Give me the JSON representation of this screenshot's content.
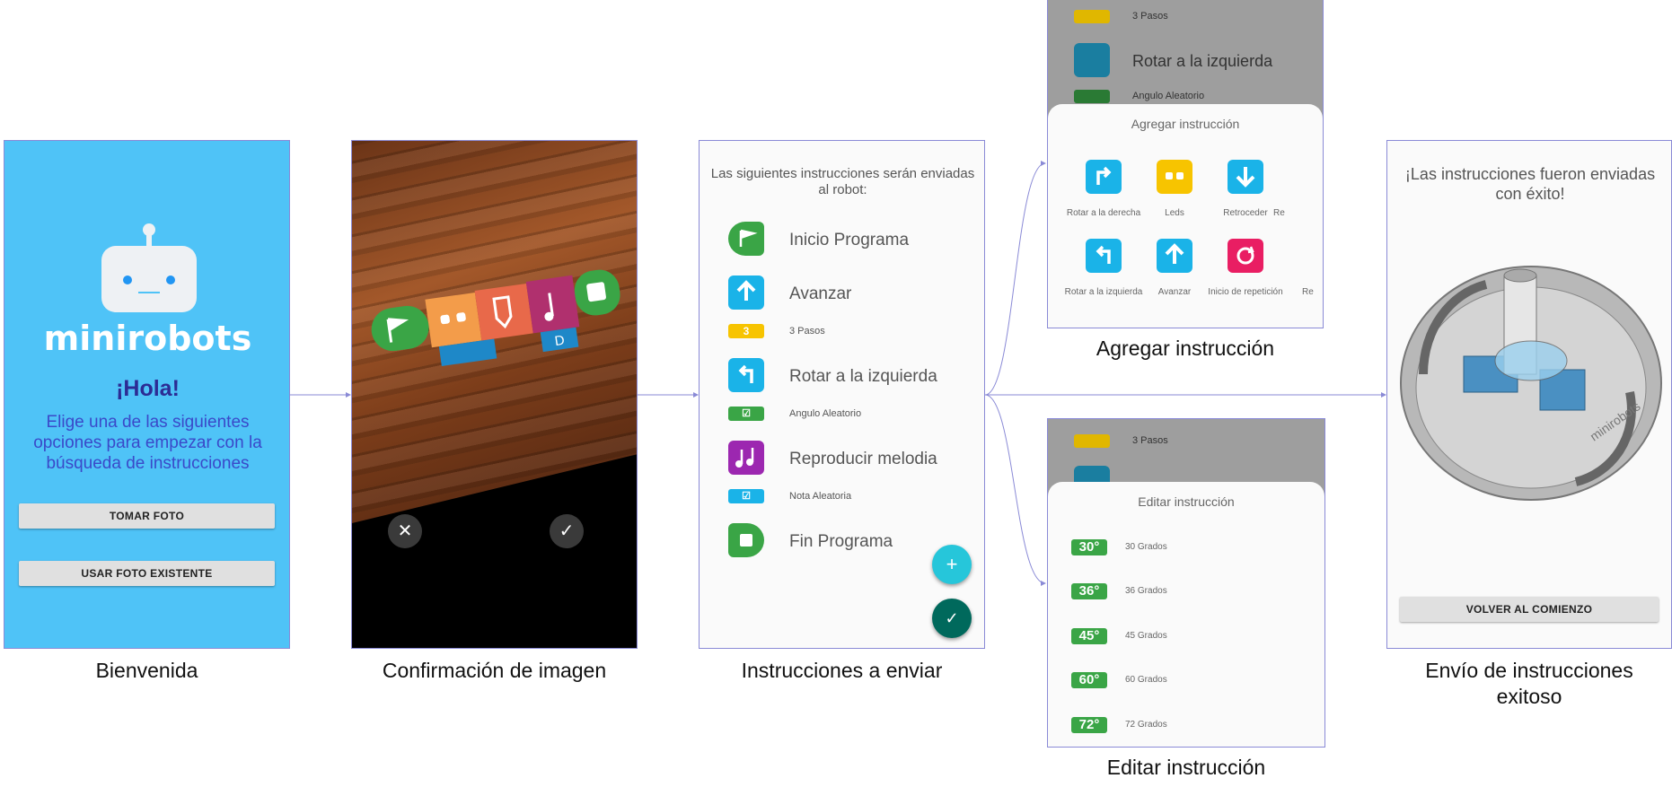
{
  "screens": {
    "welcome": {
      "brand": "minirobots",
      "greeting": "¡Hola!",
      "message": "Elige una de las siguientes opciones para empezar con la búsqueda de instrucciones",
      "take_photo": "TOMAR FOTO",
      "use_existing": "USAR FOTO EXISTENTE",
      "caption": "Bienvenida",
      "bg_color": "#4fc3f7"
    },
    "photo_confirm": {
      "block_label": "D",
      "cancel_icon": "✕",
      "confirm_icon": "✓",
      "caption": "Confirmación de imagen"
    },
    "instructions": {
      "header": "Las siguientes instrucciones serán enviadas al robot:",
      "items": [
        {
          "label": "Inicio Programa",
          "icon": "flag-icon",
          "icon_text": "INICIO",
          "color": "#3aa546",
          "param": null
        },
        {
          "label": "Avanzar",
          "icon": "arrow-up-icon",
          "icon_text": "ADELANTE",
          "color": "#1ab3e8",
          "param": {
            "tag": "3",
            "tag_unit": "PASOS",
            "tag_color": "#f7c400",
            "text": "3 Pasos"
          }
        },
        {
          "label": "Rotar a la izquierda",
          "icon": "turn-left-icon",
          "icon_text": "IZQUIERDA",
          "color": "#1ab3e8",
          "param": {
            "tag": "☑",
            "tag_unit": "ÁNGULO",
            "tag_color": "#3aa546",
            "text": "Angulo Aleatorio"
          }
        },
        {
          "label": "Reproducir melodia",
          "icon": "music-icon",
          "icon_text": "MELODÍA",
          "color": "#9c27b0",
          "param": {
            "tag": "☑",
            "tag_unit": "NOTA",
            "tag_color": "#1ab3e8",
            "text": "Nota Aleatoria"
          }
        },
        {
          "label": "Fin Programa",
          "icon": "stop-icon",
          "icon_text": "FIN",
          "color": "#3aa546",
          "param": null
        }
      ],
      "fab_add": "+",
      "fab_send": "✓",
      "caption": "Instrucciones a enviar"
    },
    "add_instruction": {
      "bg_rows": [
        {
          "tag": "3",
          "text": "3 Pasos"
        },
        {
          "label": "Rotar a la izquierda"
        },
        {
          "text": "Angulo Aleatorio"
        }
      ],
      "title": "Agregar instrucción",
      "options": [
        {
          "label": "Rotar a la derecha",
          "icon": "turn-right-icon",
          "color": "#1ab3e8"
        },
        {
          "label": "Leds",
          "icon": "leds-icon",
          "color": "#f7c400"
        },
        {
          "label": "Retroceder",
          "icon": "arrow-down-icon",
          "color": "#1ab3e8"
        },
        {
          "label": "Re",
          "icon": "partial-icon",
          "color": "#1ab3e8"
        },
        {
          "label": "Rotar a la izquierda",
          "icon": "turn-left-icon",
          "color": "#1ab3e8"
        },
        {
          "label": "Avanzar",
          "icon": "arrow-up-icon",
          "color": "#1ab3e8"
        },
        {
          "label": "Inicio de repetición",
          "icon": "repeat-icon",
          "color": "#e91e63"
        },
        {
          "label": "Re",
          "icon": "partial-icon",
          "color": "#e91e63"
        }
      ],
      "caption": "Agregar instrucción"
    },
    "edit_instruction": {
      "bg_rows": [
        {
          "tag": "3",
          "text": "3 Pasos"
        }
      ],
      "title": "Editar instrucción",
      "options": [
        {
          "value": "30°",
          "label": "30 Grados"
        },
        {
          "value": "36°",
          "label": "36 Grados"
        },
        {
          "value": "45°",
          "label": "45 Grados"
        },
        {
          "value": "60°",
          "label": "60 Grados"
        },
        {
          "value": "72°",
          "label": "72 Grados"
        }
      ],
      "caption": "Editar instrucción"
    },
    "success": {
      "message": "¡Las instrucciones fueron enviadas con éxito!",
      "back_button": "VOLVER AL COMIENZO",
      "robot_text": "minirobots",
      "caption_line1": "Envío de instrucciones",
      "caption_line2": "exitoso"
    }
  },
  "colors": {
    "connector": "#8a8ad6",
    "fab_add": "#26c6da",
    "fab_send": "#00695c"
  }
}
